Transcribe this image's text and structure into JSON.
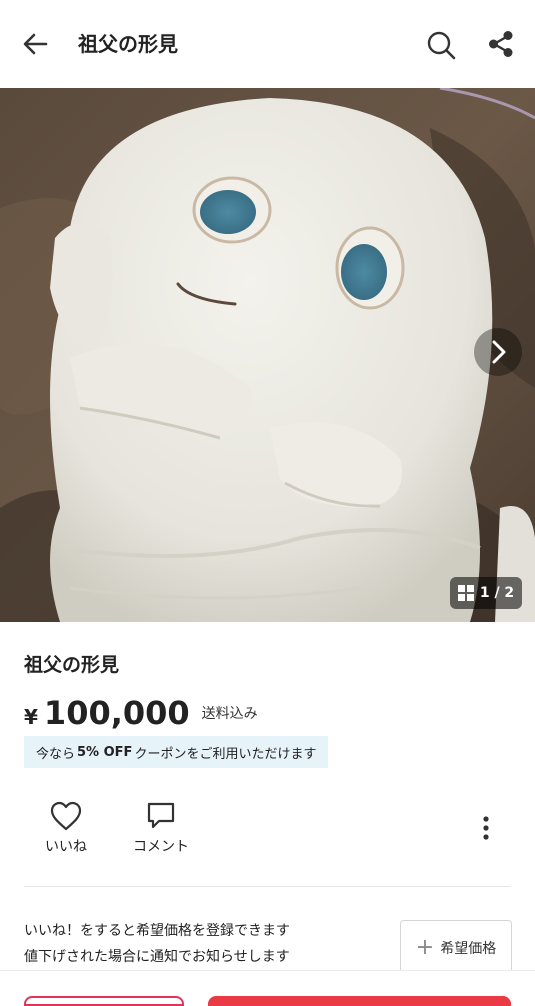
{
  "header": {
    "title": "祖父の形見",
    "icons": {
      "back": "arrow-left-icon",
      "search": "search-icon",
      "share": "share-icon"
    }
  },
  "gallery": {
    "current_index": "1",
    "total": "2",
    "counter_text": "1 / 2",
    "icons": {
      "next": "chevron-right-icon",
      "grid": "grid-icon"
    }
  },
  "item": {
    "title": "祖父の形見",
    "price_symbol": "¥",
    "price": "100,000",
    "shipping": "送料込み"
  },
  "coupon": {
    "prefix": "今なら",
    "discount": "5% OFF",
    "suffix": "クーポンをご利用いただけます"
  },
  "actions": {
    "like_label": "いいね",
    "comment_label": "コメント",
    "icons": {
      "like": "heart-icon",
      "comment": "speech-bubble-icon",
      "more": "more-vertical-icon"
    }
  },
  "notice": {
    "line1": "いいね！をすると希望価格を登録できます",
    "line2": "値下げされた場合に通知でお知らせします",
    "button_label": "希望価格"
  },
  "colors": {
    "accent": "#ea3a45",
    "coupon_bg": "#e6f3f8",
    "text": "#222222"
  }
}
